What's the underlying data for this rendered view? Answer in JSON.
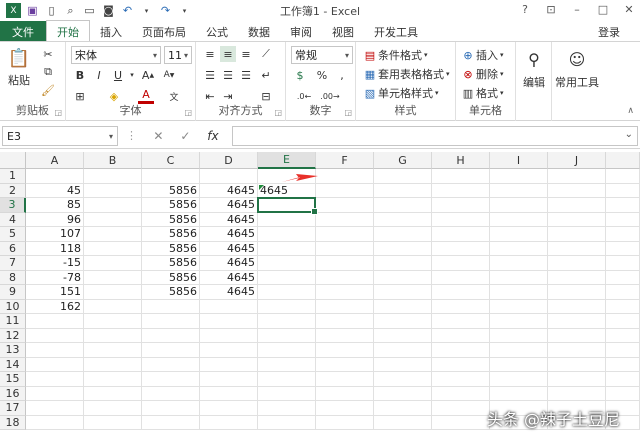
{
  "window": {
    "title": "工作簿1 - Excel",
    "controls": [
      "?",
      "⊡",
      "–",
      "□",
      "✕"
    ]
  },
  "quick_access": [
    "save-icon",
    "undo-icon",
    "redo-icon"
  ],
  "tabs": {
    "file": "文件",
    "items": [
      "开始",
      "插入",
      "页面布局",
      "公式",
      "数据",
      "审阅",
      "视图",
      "开发工具"
    ],
    "active": "开始",
    "login": "登录"
  },
  "ribbon": {
    "clipboard": {
      "label": "剪贴板",
      "paste": "粘贴"
    },
    "font": {
      "label": "字体",
      "name": "宋体",
      "size": "11",
      "bold": "B",
      "italic": "I",
      "underline": "U"
    },
    "alignment": {
      "label": "对齐方式"
    },
    "number": {
      "label": "数字",
      "format": "常规"
    },
    "styles": {
      "label": "样式",
      "cond": "条件格式",
      "table": "套用表格格式",
      "cell": "单元格样式"
    },
    "cells": {
      "label": "单元格",
      "insert": "插入",
      "delete": "删除",
      "format": "格式"
    },
    "editing": {
      "label": "编辑"
    },
    "tools": {
      "label": "常用工具"
    }
  },
  "formula_bar": {
    "name_box": "E3",
    "fx": "fx",
    "value": ""
  },
  "sheet": {
    "columns": [
      "A",
      "B",
      "C",
      "D",
      "E",
      "F",
      "G",
      "H",
      "I",
      "J"
    ],
    "selected_column": "E",
    "rows": [
      "1",
      "2",
      "3",
      "4",
      "5",
      "6",
      "7",
      "8",
      "9",
      "10",
      "11",
      "12",
      "13",
      "14",
      "15",
      "16",
      "17",
      "18"
    ],
    "selected_row": "3",
    "active_cell": "E3",
    "col_a": [
      "",
      "45",
      "85",
      "96",
      "107",
      "118",
      "-15",
      "-78",
      "151",
      "162"
    ],
    "col_c": [
      "",
      "5856",
      "5856",
      "5856",
      "5856",
      "5856",
      "5856",
      "5856",
      "5856",
      ""
    ],
    "col_d": [
      "",
      "4645",
      "4645",
      "4645",
      "4645",
      "4645",
      "4645",
      "4645",
      "4645",
      ""
    ],
    "e2": "4645"
  },
  "watermark": "头条 @辣子土豆尼",
  "colors": {
    "accent": "#217346",
    "arrow": "#e8302a"
  }
}
